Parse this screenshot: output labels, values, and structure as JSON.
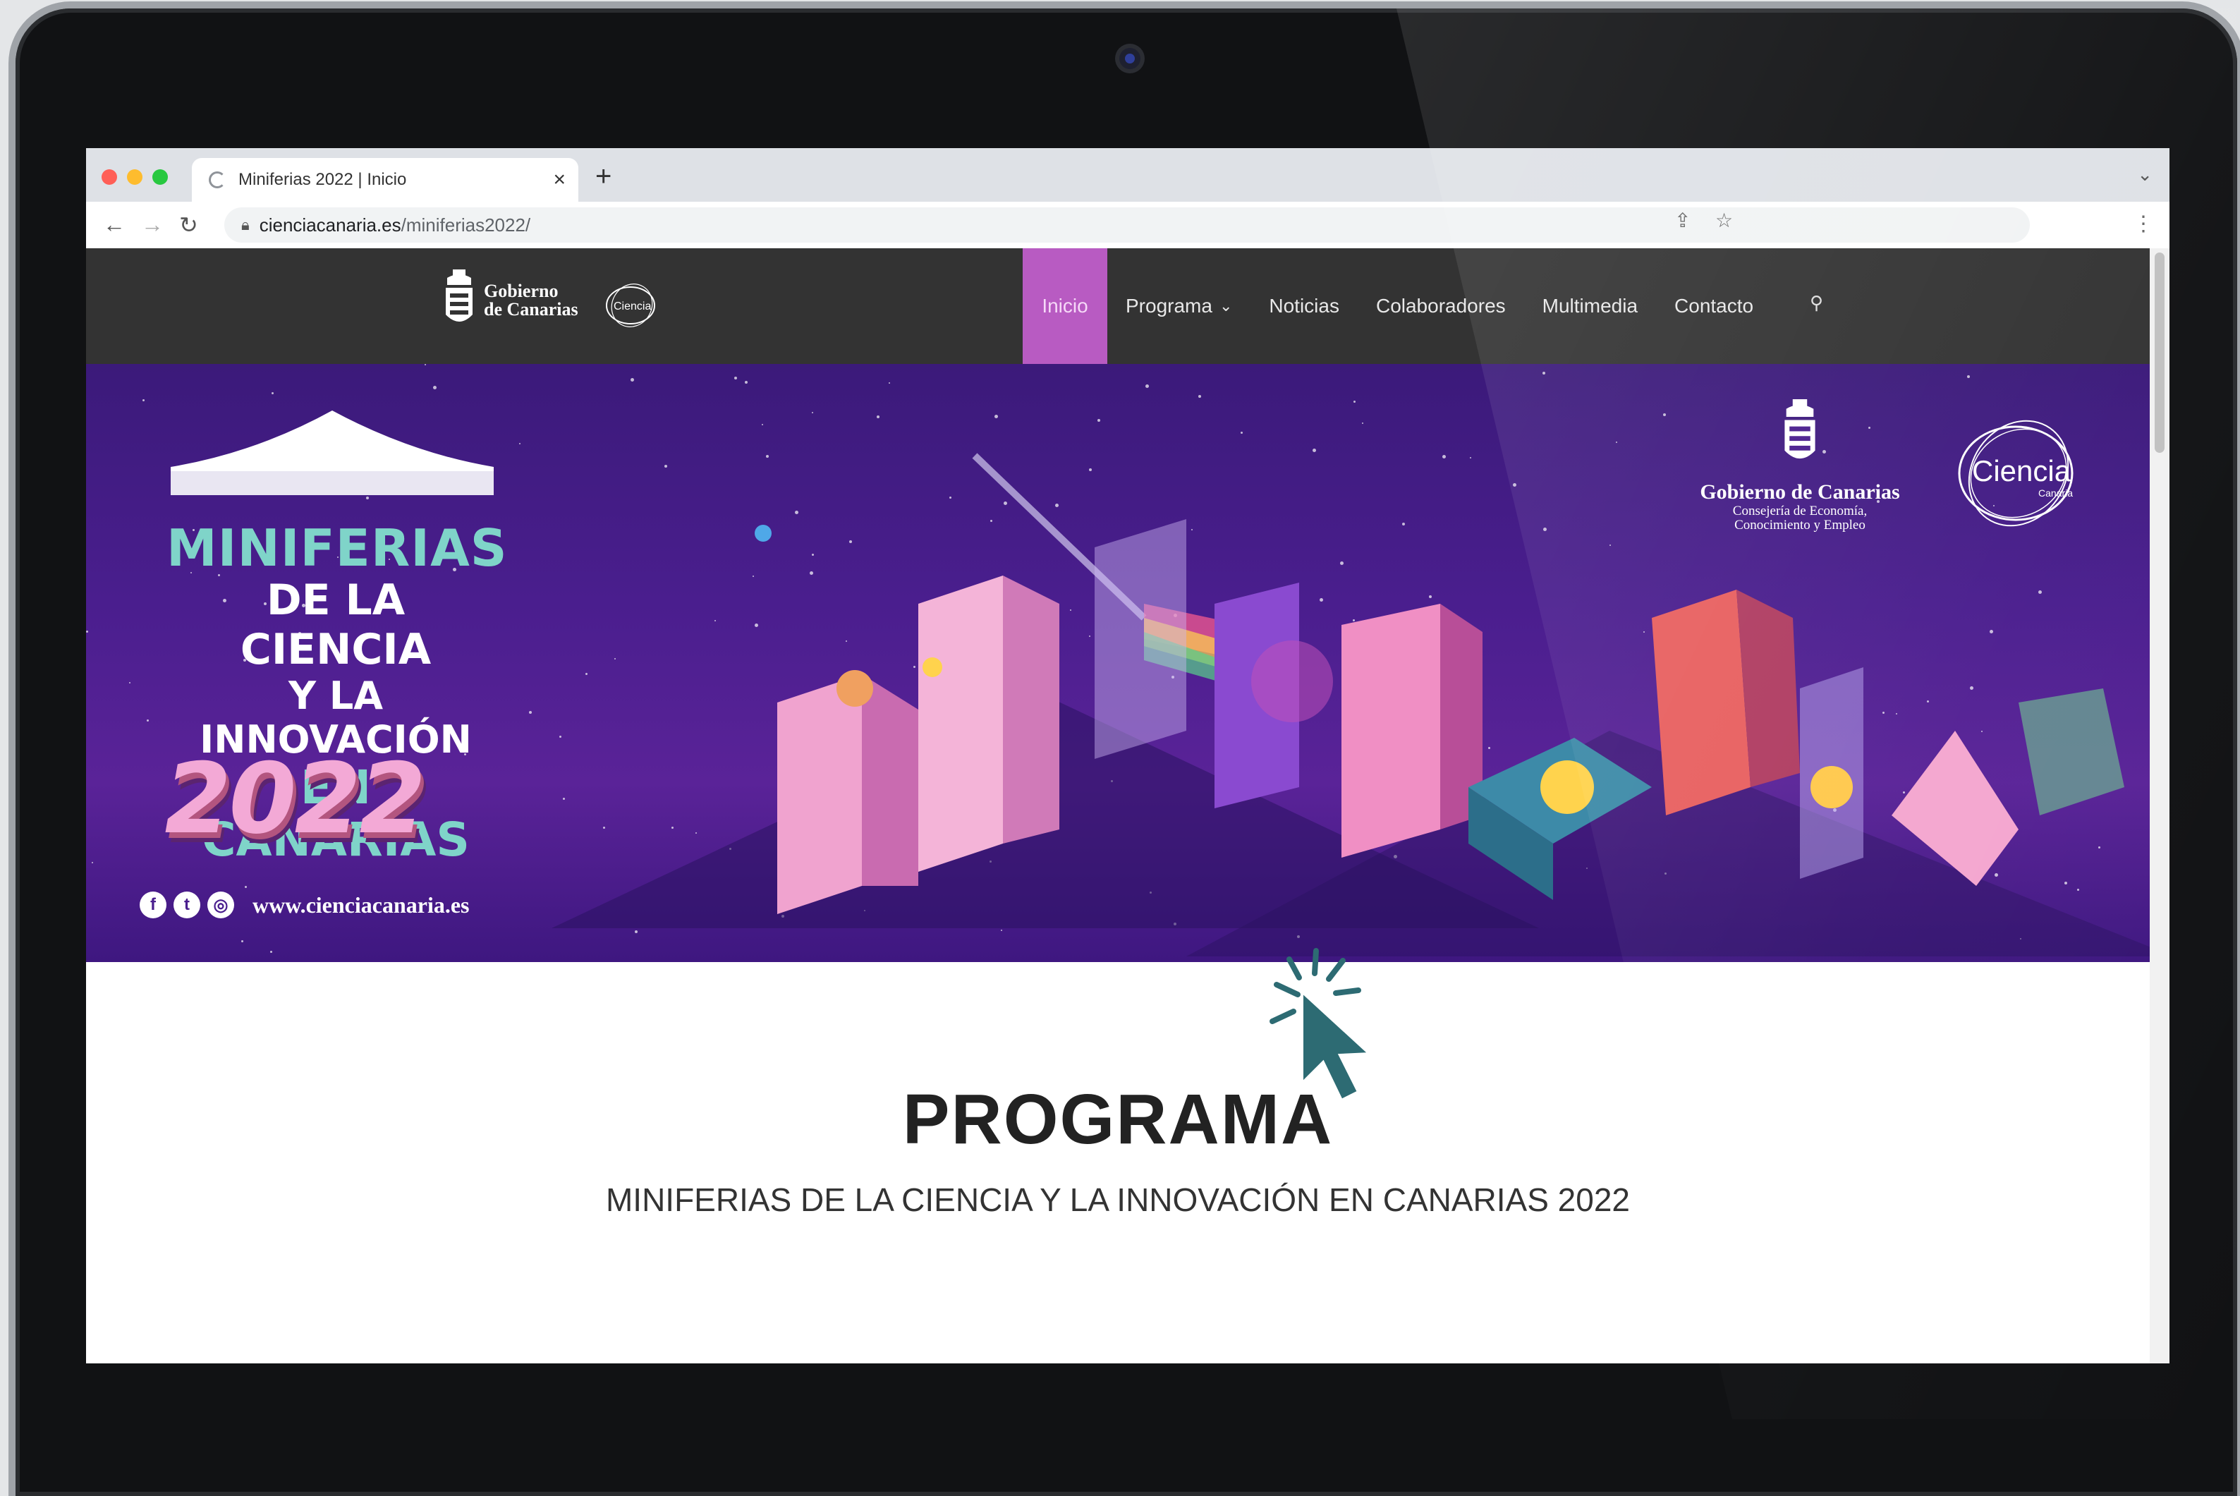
{
  "browser": {
    "tab_title": "Miniferias 2022 | Inicio",
    "url_host": "cienciacanaria.es",
    "url_path": "/miniferias2022/"
  },
  "site": {
    "logo_gc_line1": "Gobierno",
    "logo_gc_line2": "de Canarias",
    "logo_ciencia": "Ciencia",
    "nav": [
      {
        "label": "Inicio",
        "active": true
      },
      {
        "label": "Programa",
        "has_dropdown": true
      },
      {
        "label": "Noticias"
      },
      {
        "label": "Colaboradores"
      },
      {
        "label": "Multimedia"
      },
      {
        "label": "Contacto"
      }
    ]
  },
  "hero": {
    "title_line1": "MINIFERIAS",
    "title_line2": "DE LA CIENCIA",
    "title_line3": "Y LA INNOVACIÓN",
    "title_line4": "EN CANARIAS",
    "year": "2022",
    "website": "www.cienciacanaria.es",
    "gc_name": "Gobierno de Canarias",
    "gc_sub1": "Consejería de Economía,",
    "gc_sub2": "Conocimiento y Empleo",
    "ciencia_logo": "Ciencia",
    "ciencia_logo_sub": "Canaria",
    "colors": {
      "bg": "#4a1e8e",
      "teal": "#7fd4c9",
      "pink": "#f3a9d6"
    }
  },
  "content": {
    "title": "PROGRAMA",
    "subtitle": "MINIFERIAS DE LA CIENCIA Y LA INNOVACIÓN EN CANARIAS 2022"
  },
  "colors": {
    "nav_bg": "#333333",
    "nav_active": "#b85bc2",
    "cursor": "#2d6b73"
  }
}
